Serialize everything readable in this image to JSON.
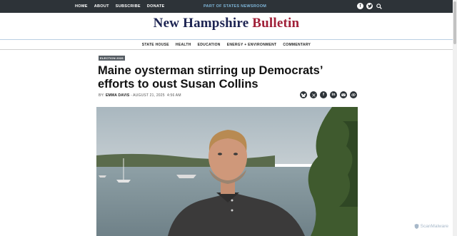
{
  "top_nav": [
    "HOME",
    "ABOUT",
    "SUBSCRIBE",
    "DONATE"
  ],
  "network_label": "PART OF STATES NEWSROOM",
  "header_icons": [
    "facebook-icon",
    "twitter-icon",
    "search-icon"
  ],
  "logo": {
    "part1": "New Hampshire",
    "part2": "Bulletin"
  },
  "sections": [
    "STATE HOUSE",
    "HEALTH",
    "EDUCATION",
    "ENERGY + ENVIRONMENT",
    "COMMENTARY"
  ],
  "article": {
    "tag": "ELECTION 2026",
    "headline": "Maine oysterman stirring up Democrats’ efforts to oust Susan Collins",
    "byline_prefix": "BY:",
    "author": "EMMA DAVIS",
    "date": "- AUGUST 21, 2025",
    "time": "4:56 AM"
  },
  "share_icons": [
    "bluesky-icon",
    "x-icon",
    "facebook-icon",
    "linkedin-icon",
    "email-icon",
    "link-icon"
  ],
  "watermark": "ScanMalware",
  "colors": {
    "topbar": "#2d3338",
    "logo_primary": "#1d2452",
    "logo_accent": "#a02038",
    "network_link": "#7fb6d9"
  }
}
